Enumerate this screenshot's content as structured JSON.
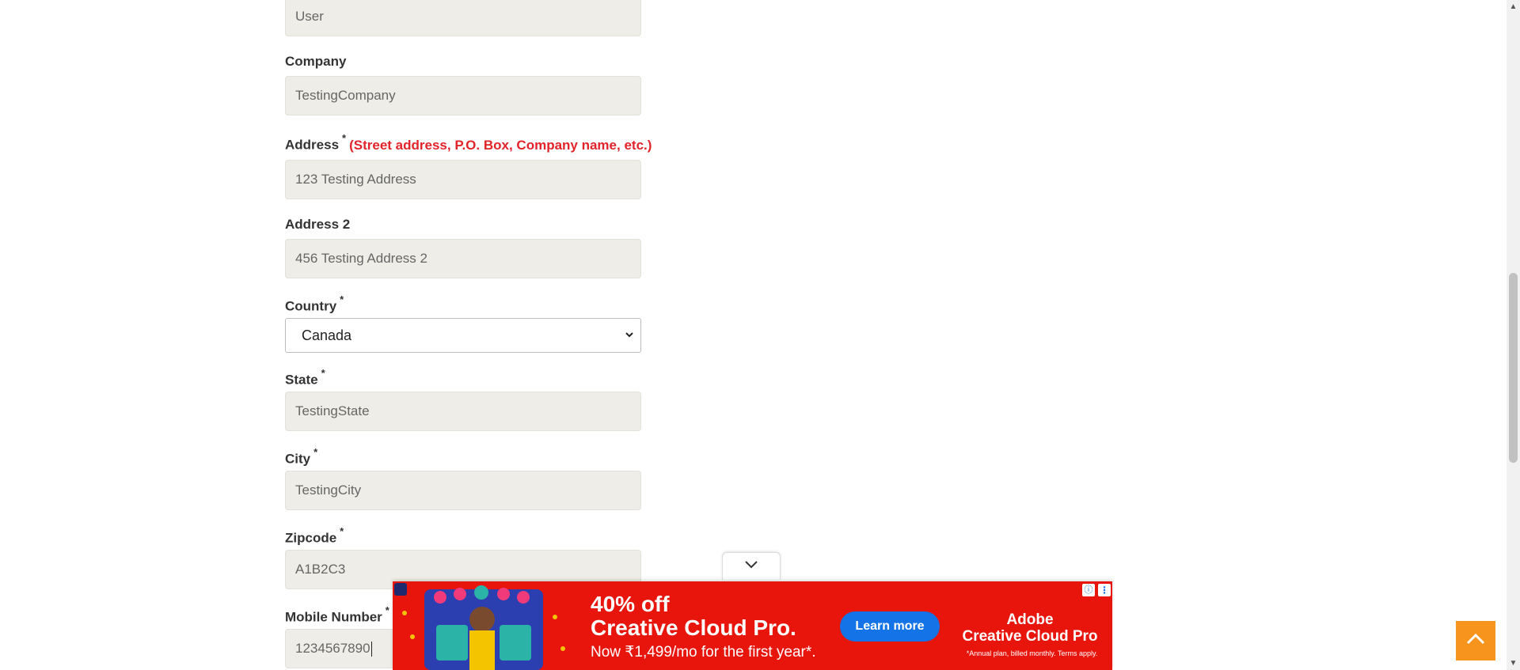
{
  "form": {
    "user_value": "User",
    "company": {
      "label": "Company",
      "value": "TestingCompany"
    },
    "address": {
      "label": "Address",
      "required": "*",
      "hint": "(Street address, P.O. Box, Company name, etc.)",
      "value": "123 Testing Address"
    },
    "address2": {
      "label": "Address 2",
      "value": "456 Testing Address 2"
    },
    "country": {
      "label": "Country",
      "required": "*",
      "selected": "Canada"
    },
    "state": {
      "label": "State",
      "required": "*",
      "value": "TestingState"
    },
    "city": {
      "label": "City",
      "required": "*",
      "value": "TestingCity"
    },
    "zipcode": {
      "label": "Zipcode",
      "required": "*",
      "value": "A1B2C3"
    },
    "mobile": {
      "label": "Mobile Number",
      "required": "*",
      "value": "1234567890"
    }
  },
  "ad": {
    "headline_line1": "40% off",
    "headline_line2": "Creative Cloud Pro.",
    "subline": "Now ₹1,499/mo for the first year*.",
    "button": "Learn more",
    "brand_line1": "Adobe",
    "brand_line2": "Creative Cloud Pro",
    "terms": "*Annual plan, billed monthly. Terms apply.",
    "info_icon": "ⓘ",
    "more_icon": "⋮"
  },
  "colors": {
    "accent_orange": "#f7941d",
    "ad_red": "#e8150d",
    "ad_blue": "#1473e6",
    "hint_red": "#e2232a"
  }
}
